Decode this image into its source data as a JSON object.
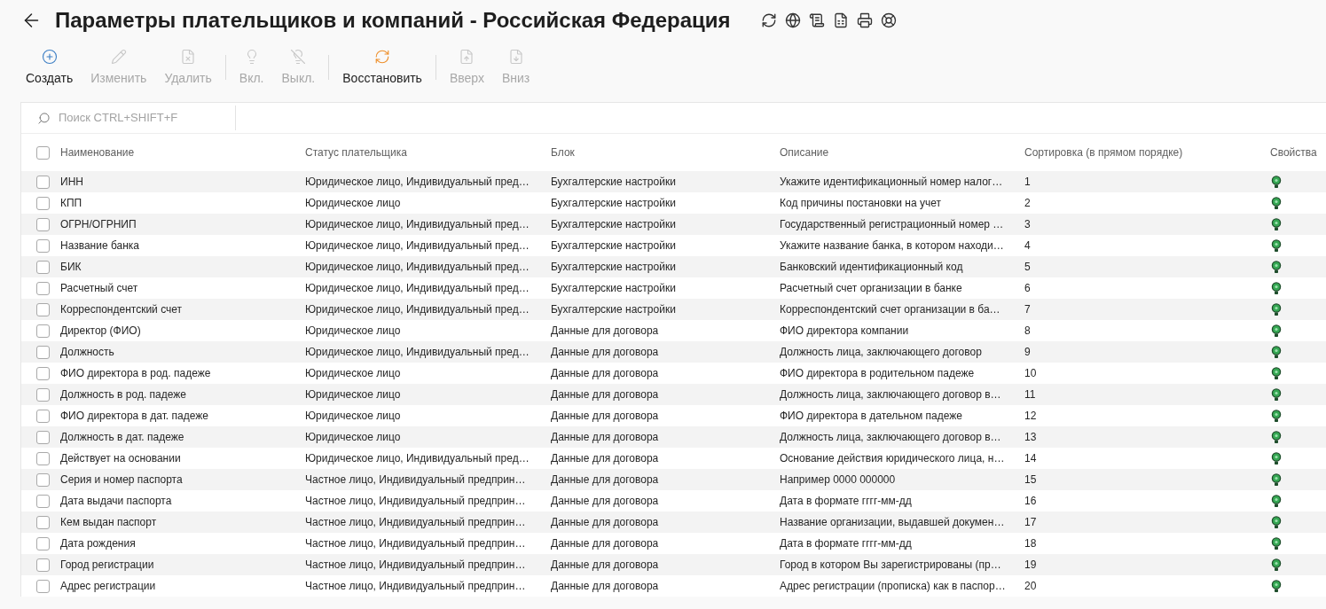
{
  "page": {
    "title": "Параметры плательщиков и компаний - Российская Федерация"
  },
  "toolbar": {
    "groups": [
      {
        "buttons": [
          {
            "label": "Создать",
            "disabled": false
          },
          {
            "label": "Изменить",
            "disabled": true
          },
          {
            "label": "Удалить",
            "disabled": true
          }
        ]
      },
      {
        "buttons": [
          {
            "label": "Вкл.",
            "disabled": true
          },
          {
            "label": "Выкл.",
            "disabled": true
          }
        ]
      },
      {
        "buttons": [
          {
            "label": "Восстановить",
            "disabled": false
          }
        ]
      },
      {
        "buttons": [
          {
            "label": "Вверх",
            "disabled": true
          },
          {
            "label": "Вниз",
            "disabled": true
          }
        ]
      }
    ]
  },
  "search": {
    "placeholder": "Поиск CTRL+SHIFT+F"
  },
  "table": {
    "select_all_checked": false,
    "columns": [
      "Наименование",
      "Статус плательщика",
      "Блок",
      "Описание",
      "Сортировка (в прямом порядке)",
      "Свойства"
    ],
    "rows": [
      {
        "checked": false,
        "name": "ИНН",
        "payer_status": "Юридическое лицо, Индивидуальный пред…",
        "block": "Бухгалтерские настройки",
        "description": "Укажите идентификационный номер налог…",
        "sort": "1",
        "enabled": true
      },
      {
        "checked": false,
        "name": "КПП",
        "payer_status": "Юридическое лицо",
        "block": "Бухгалтерские настройки",
        "description": "Код причины постановки на учет",
        "sort": "2",
        "enabled": true
      },
      {
        "checked": false,
        "name": "ОГРН/ОГРНИП",
        "payer_status": "Юридическое лицо, Индивидуальный пред…",
        "block": "Бухгалтерские настройки",
        "description": "Государственный регистрационный номер …",
        "sort": "3",
        "enabled": true
      },
      {
        "checked": false,
        "name": "Название банка",
        "payer_status": "Юридическое лицо, Индивидуальный пред…",
        "block": "Бухгалтерские настройки",
        "description": "Укажите название банка, в котором находи…",
        "sort": "4",
        "enabled": true
      },
      {
        "checked": false,
        "name": "БИК",
        "payer_status": "Юридическое лицо, Индивидуальный пред…",
        "block": "Бухгалтерские настройки",
        "description": "Банковский идентификационный код",
        "sort": "5",
        "enabled": true
      },
      {
        "checked": false,
        "name": "Расчетный счет",
        "payer_status": "Юридическое лицо, Индивидуальный пред…",
        "block": "Бухгалтерские настройки",
        "description": "Расчетный счет организации в банке",
        "sort": "6",
        "enabled": true
      },
      {
        "checked": false,
        "name": "Корреспондентский счет",
        "payer_status": "Юридическое лицо, Индивидуальный пред…",
        "block": "Бухгалтерские настройки",
        "description": "Корреспондентский счет организации в ба…",
        "sort": "7",
        "enabled": true
      },
      {
        "checked": false,
        "name": "Директор (ФИО)",
        "payer_status": "Юридическое лицо",
        "block": "Данные для договора",
        "description": "ФИО директора компании",
        "sort": "8",
        "enabled": true
      },
      {
        "checked": false,
        "name": "Должность",
        "payer_status": "Юридическое лицо, Индивидуальный пред…",
        "block": "Данные для договора",
        "description": "Должность лица, заключающего договор",
        "sort": "9",
        "enabled": true
      },
      {
        "checked": false,
        "name": "ФИО директора в род. падеже",
        "payer_status": "Юридическое лицо",
        "block": "Данные для договора",
        "description": "ФИО директора в родительном падеже",
        "sort": "10",
        "enabled": true
      },
      {
        "checked": false,
        "name": "Должность в род. падеже",
        "payer_status": "Юридическое лицо",
        "block": "Данные для договора",
        "description": "Должность лица, заключающего договор в…",
        "sort": "11",
        "enabled": true
      },
      {
        "checked": false,
        "name": "ФИО директора в дат. падеже",
        "payer_status": "Юридическое лицо",
        "block": "Данные для договора",
        "description": "ФИО директора в дательном падеже",
        "sort": "12",
        "enabled": true
      },
      {
        "checked": false,
        "name": "Должность в дат. падеже",
        "payer_status": "Юридическое лицо",
        "block": "Данные для договора",
        "description": "Должность лица, заключающего договор в…",
        "sort": "13",
        "enabled": true
      },
      {
        "checked": false,
        "name": "Действует на основании",
        "payer_status": "Юридическое лицо, Индивидуальный пред…",
        "block": "Данные для договора",
        "description": "Основание действия юридического лица, н…",
        "sort": "14",
        "enabled": true
      },
      {
        "checked": false,
        "name": "Серия и номер паспорта",
        "payer_status": "Частное лицо, Индивидуальный предприн…",
        "block": "Данные для договора",
        "description": "Например 0000 000000",
        "sort": "15",
        "enabled": true
      },
      {
        "checked": false,
        "name": "Дата выдачи паспорта",
        "payer_status": "Частное лицо, Индивидуальный предприн…",
        "block": "Данные для договора",
        "description": "Дата в формате гггг-мм-дд",
        "sort": "16",
        "enabled": true
      },
      {
        "checked": false,
        "name": "Кем выдан паспорт",
        "payer_status": "Частное лицо, Индивидуальный предприн…",
        "block": "Данные для договора",
        "description": "Название организации, выдавшей докумен…",
        "sort": "17",
        "enabled": true
      },
      {
        "checked": false,
        "name": "Дата рождения",
        "payer_status": "Частное лицо, Индивидуальный предприн…",
        "block": "Данные для договора",
        "description": "Дата в формате гггг-мм-дд",
        "sort": "18",
        "enabled": true
      },
      {
        "checked": false,
        "name": "Город регистрации",
        "payer_status": "Частное лицо, Индивидуальный предприн…",
        "block": "Данные для договора",
        "description": "Город в котором Вы зарегистрированы (пр…",
        "sort": "19",
        "enabled": true
      },
      {
        "checked": false,
        "name": "Адрес регистрации",
        "payer_status": "Частное лицо, Индивидуальный предприн…",
        "block": "Данные для договора",
        "description": "Адрес регистрации (прописка) как в паспор…",
        "sort": "20",
        "enabled": true
      }
    ]
  }
}
